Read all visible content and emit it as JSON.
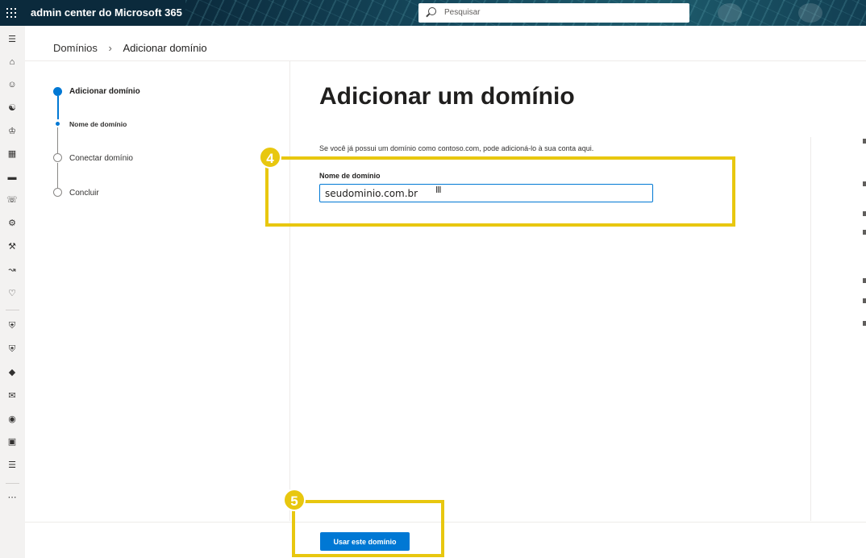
{
  "app": {
    "title": "admin center do Microsoft 365",
    "search_placeholder": "Pesquisar"
  },
  "rail": {
    "icons": [
      "menu-icon",
      "home-icon",
      "user-icon",
      "groups-icon",
      "roles-icon",
      "resources-icon",
      "billing-icon",
      "support-icon",
      "settings-icon",
      "setup-icon",
      "reports-icon",
      "health-icon",
      "security-icon",
      "compliance-icon",
      "endpoint-icon",
      "exchange-icon",
      "sharepoint-icon",
      "teams-icon",
      "all-admin-centers-icon",
      "more-icon"
    ]
  },
  "breadcrumb": {
    "parent": "Domínios",
    "current": "Adicionar domínio"
  },
  "steps": {
    "step1": "Adicionar domínio",
    "step1_sub": "Nome de domínio",
    "step2": "Conectar domínio",
    "step3": "Concluir"
  },
  "main": {
    "title": "Adicionar um domínio",
    "intro": "Se você já possui um domínio como contoso.com, pode adicioná-lo à sua conta aqui.",
    "field_label": "Nome de domínio",
    "field_value": "seudominio.com.br"
  },
  "annotations": {
    "badge_field": "4",
    "badge_button": "5",
    "color": "#e8c70f"
  },
  "footer": {
    "primary_button": "Usar este domínio"
  },
  "colors": {
    "accent": "#0078d4",
    "topbar": "#0b2a3c"
  }
}
